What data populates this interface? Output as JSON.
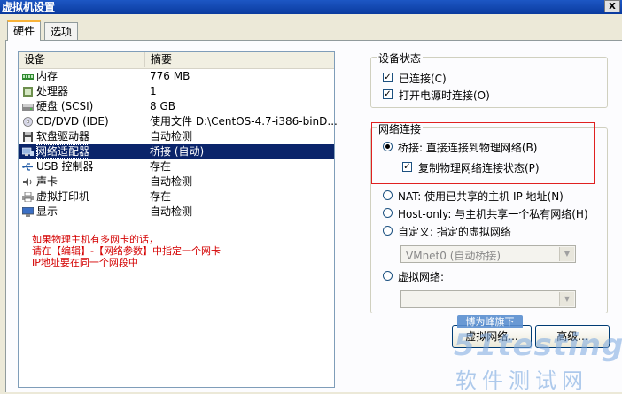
{
  "window": {
    "title": "虚拟机设置",
    "close_label": "X"
  },
  "tabs": [
    {
      "label": "硬件",
      "active": true
    },
    {
      "label": "选项",
      "active": false
    }
  ],
  "device_list": {
    "columns": [
      "设备",
      "摘要"
    ],
    "rows": [
      {
        "icon": "memory-icon",
        "name": "内存",
        "summary": "776 MB"
      },
      {
        "icon": "cpu-icon",
        "name": "处理器",
        "summary": "1"
      },
      {
        "icon": "harddisk-icon",
        "name": "硬盘 (SCSI)",
        "summary": "8 GB"
      },
      {
        "icon": "cdrom-icon",
        "name": "CD/DVD (IDE)",
        "summary": "使用文件 D:\\CentOS-4.7-i386-binD..."
      },
      {
        "icon": "floppy-icon",
        "name": "软盘驱动器",
        "summary": "自动检测"
      },
      {
        "icon": "network-adapter-icon",
        "name": "网络适配器",
        "summary": "桥接 (自动)",
        "selected": true
      },
      {
        "icon": "usb-icon",
        "name": "USB 控制器",
        "summary": "存在"
      },
      {
        "icon": "sound-icon",
        "name": "声卡",
        "summary": "自动检测"
      },
      {
        "icon": "printer-icon",
        "name": "虚拟打印机",
        "summary": "存在"
      },
      {
        "icon": "display-icon",
        "name": "显示",
        "summary": "自动检测"
      }
    ]
  },
  "annotation": {
    "line1": "如果物理主机有多网卡的话，",
    "line2": "请在【编辑】-【网络参数】中指定一个网卡",
    "line3": "IP地址要在同一个网段中"
  },
  "device_status": {
    "legend": "设备状态",
    "connected_label": "已连接(C)",
    "connected_checked": true,
    "connect_at_power_on_label": "打开电源时连接(O)",
    "connect_at_power_on_checked": true
  },
  "network_connection": {
    "legend": "网络连接",
    "bridged_label": "桥接: 直接连接到物理网络(B)",
    "replicate_label": "复制物理网络连接状态(P)",
    "replicate_checked": true,
    "nat_label": "NAT: 使用已共享的主机 IP 地址(N)",
    "hostonly_label": "Host-only: 与主机共享一个私有网络(H)",
    "custom_label": "自定义: 指定的虚拟网络",
    "custom_combo_value": "VMnet0 (自动桥接)",
    "lan_segment_label": "虚拟网络:",
    "lan_segment_combo_value": "",
    "selected": "bridged"
  },
  "buttons": {
    "virtual_network": "虚拟网络...",
    "advanced": "高级..."
  },
  "watermark": {
    "badge": "博为峰旗下",
    "brand": "51testing",
    "cn": "软件测试网"
  },
  "colors": {
    "selection": "#0a246a",
    "highlight_box": "#e02020",
    "annotation_text": "#d40000"
  }
}
